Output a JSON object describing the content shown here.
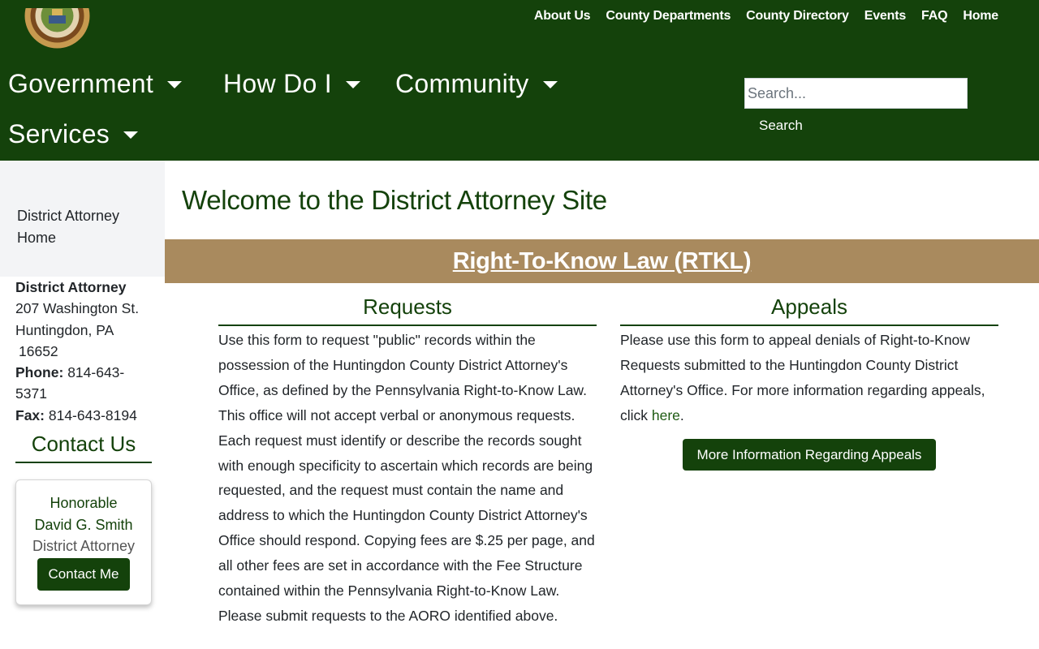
{
  "header": {
    "top_links": [
      "About Us",
      "County Departments",
      "County Directory",
      "Events",
      "FAQ",
      "Home"
    ],
    "nav": {
      "government": "Government",
      "how_do_i": "How Do I",
      "community": "Community",
      "services": "Services"
    },
    "search": {
      "placeholder": "Search...",
      "button": "Search"
    },
    "brand_color": "#14420b"
  },
  "sidebar": {
    "nav_link": "District Attorney Home",
    "office_name": "District Attorney",
    "address_line1": "207 Washington St.",
    "address_line2": "Huntingdon, PA",
    "zip": "16652",
    "phone_label": "Phone:",
    "phone": "814-643-5371",
    "fax_label": "Fax:",
    "fax": "814-643-8194",
    "contact_title": "Contact Us",
    "card": {
      "honorific": "Honorable",
      "name": "David G. Smith",
      "role": "District Attorney",
      "button": "Contact Me"
    }
  },
  "main": {
    "title": "Welcome to the District Attorney Site",
    "banner_link": "Right-To-Know Law (RTKL)",
    "banner_color": "#a98a5e",
    "requests": {
      "heading": "Requests",
      "body": "Use this form to request \"public\" records within the possession of the Huntingdon County District Attorney's Office, as defined by the Pennsylvania Right-to-Know Law. This office will not accept verbal or anonymous requests. Each request must identify or describe the records sought with enough specificity to ascertain which records are being requested, and the request must contain the name and address to which the Huntingdon County District Attorney's Office should respond. Copying fees are $.25  per page, and all other fees are set in accordance with the Fee Structure contained within the Pennsylvania Right-to-Know Law.",
      "note": "Please submit requests to the AORO identified above."
    },
    "appeals": {
      "heading": "Appeals",
      "body": "Please use this form to appeal denials of Right-to-Know Requests submitted to the Huntingdon County District Attorney's Office. For more information regarding appeals, click ",
      "link": "here",
      "period": ".",
      "button": "More Information Regarding Appeals"
    }
  }
}
